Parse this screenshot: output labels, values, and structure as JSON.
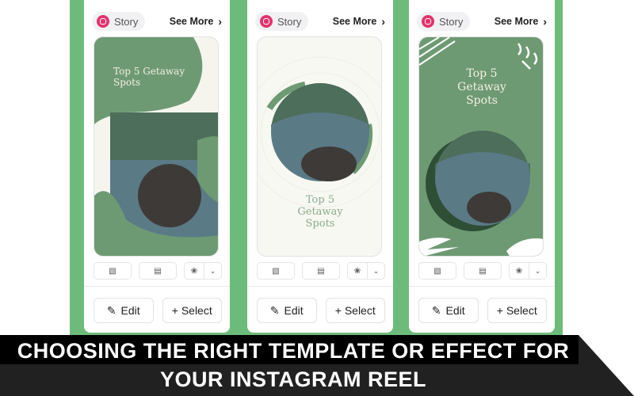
{
  "cards": [
    {
      "badge": "Story",
      "see_more": "See More",
      "title": "Top 5 Getaway Spots",
      "edit": "Edit",
      "select": "+ Select"
    },
    {
      "badge": "Story",
      "see_more": "See More",
      "title": "Top 5 Getaway Spots",
      "edit": "Edit",
      "select": "+ Select"
    },
    {
      "badge": "Story",
      "see_more": "See More",
      "title": "Top 5 Getaway Spots",
      "edit": "Edit",
      "select": "+ Select"
    }
  ],
  "icons": {
    "chevron": "›",
    "pencil": "✎",
    "dropdown": "⌄"
  },
  "colors": {
    "green_bg": "#6dbb7b",
    "template_green": "#6e9a73",
    "instagram": "#e2336b"
  },
  "banner": {
    "line1": "CHOOSING THE RIGHT TEMPLATE OR EFFECT FOR",
    "line2": "YOUR INSTAGRAM REEL"
  }
}
